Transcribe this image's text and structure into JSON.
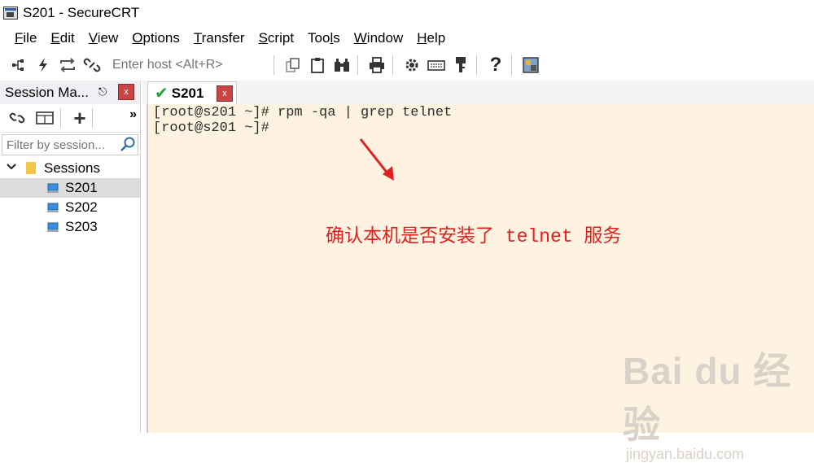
{
  "window": {
    "title": "S201 - SecureCRT"
  },
  "menu": [
    {
      "label": "File",
      "u": "F",
      "rest": "ile"
    },
    {
      "label": "Edit",
      "u": "E",
      "rest": "dit"
    },
    {
      "label": "View",
      "u": "V",
      "rest": "iew"
    },
    {
      "label": "Options",
      "u": "O",
      "rest": "ptions"
    },
    {
      "label": "Transfer",
      "u": "T",
      "rest": "ransfer"
    },
    {
      "label": "Script",
      "u": "S",
      "rest": "cript"
    },
    {
      "label": "Tools",
      "pre": "Too",
      "u": "l",
      "rest": "s"
    },
    {
      "label": "Window",
      "u": "W",
      "rest": "indow"
    },
    {
      "label": "Help",
      "u": "H",
      "rest": "elp"
    }
  ],
  "toolbar": {
    "host_placeholder": "Enter host <Alt+R>",
    "icons": [
      "connect-icon",
      "quick-connect-icon",
      "reconnect-icon",
      "disconnect-icon",
      "copy-icon",
      "paste-icon",
      "find-icon",
      "print-icon",
      "settings-icon",
      "keymap-icon",
      "key-icon",
      "help-icon",
      "sftp-icon"
    ]
  },
  "sidebar": {
    "title": "Session Ma...",
    "filter_placeholder": "Filter by session...",
    "folder": "Sessions",
    "sessions": [
      "S201",
      "S202",
      "S203"
    ],
    "selected": "S201"
  },
  "tab": {
    "label": "S201",
    "status": "connected"
  },
  "terminal": {
    "lines": [
      "[root@s201 ~]# rpm -qa | grep telnet",
      "[root@s201 ~]#"
    ]
  },
  "annotation": {
    "text": "确认本机是否安装了 telnet 服务",
    "color": "#e02020"
  },
  "watermark": {
    "main": "Bai du 经验",
    "sub": "jingyan.baidu.com"
  }
}
